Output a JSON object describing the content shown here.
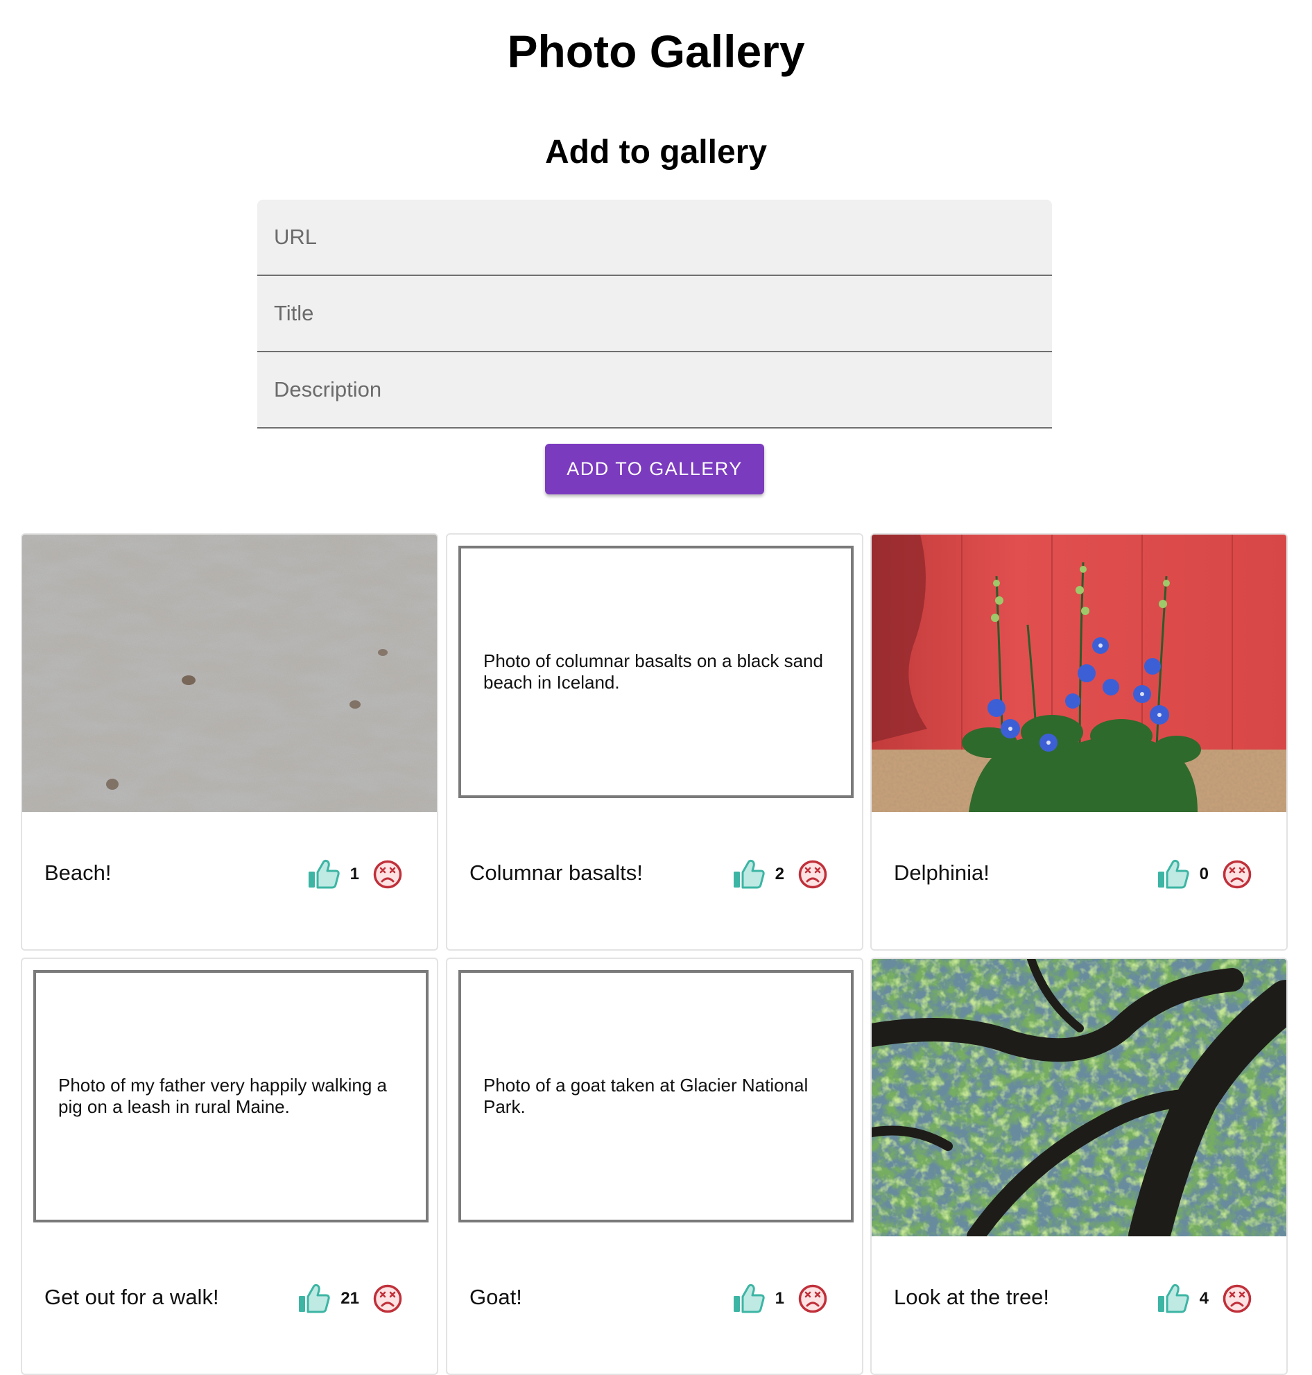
{
  "header": {
    "title": "Photo Gallery"
  },
  "form": {
    "heading": "Add to gallery",
    "url_placeholder": "URL",
    "title_placeholder": "Title",
    "description_placeholder": "Description",
    "submit_label": "ADD TO GALLERY"
  },
  "colors": {
    "accent": "#7b3bbf",
    "like": "#3cb5a4",
    "dislike": "#c0303a"
  },
  "gallery": {
    "items": [
      {
        "title": "Beach!",
        "likes": "1",
        "display": "image",
        "image": "sand-texture"
      },
      {
        "title": "Columnar basalts!",
        "likes": "2",
        "display": "description",
        "description": "Photo of columnar basalts on a black sand beach in Iceland."
      },
      {
        "title": "Delphinia!",
        "likes": "0",
        "display": "image",
        "image": "blue-delphinium-flowers-against-red-wall"
      },
      {
        "title": "Get out for a walk!",
        "likes": "21",
        "display": "description",
        "description": "Photo of my father very happily walking a pig on a leash in rural Maine."
      },
      {
        "title": "Goat!",
        "likes": "1",
        "display": "description",
        "description": "Photo of a goat taken at Glacier National Park."
      },
      {
        "title": "Look at the tree!",
        "likes": "4",
        "display": "image",
        "image": "tree-canopy-from-below"
      }
    ]
  }
}
